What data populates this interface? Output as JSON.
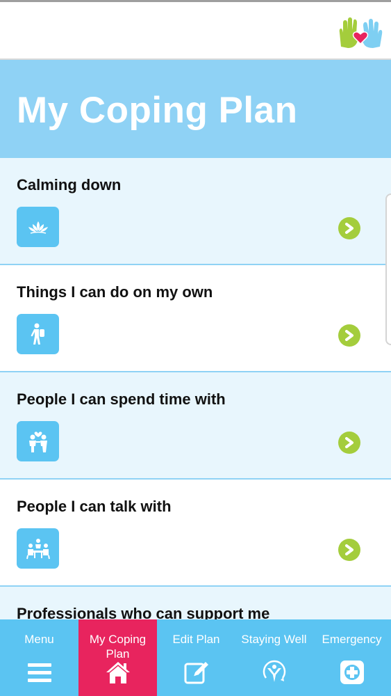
{
  "header": {
    "logo_icon": "helping-hands-heart-logo"
  },
  "page": {
    "title": "My Coping Plan"
  },
  "items": [
    {
      "label": "Calming down",
      "icon": "lotus-icon"
    },
    {
      "label": "Things I can do on my own",
      "icon": "hiker-icon"
    },
    {
      "label": "People I can spend time with",
      "icon": "couple-icon"
    },
    {
      "label": "People I can talk with",
      "icon": "group-talk-icon"
    },
    {
      "label": "Professionals who can support me",
      "icon": "professional-icon"
    }
  ],
  "nav": {
    "menu": "Menu",
    "coping_plan": "My Coping Plan",
    "edit_plan": "Edit Plan",
    "staying_well": "Staying Well",
    "emergency": "Emergency"
  },
  "colors": {
    "header_band": "#8fd2f5",
    "tile_blue": "#5bc4f2",
    "chevron_green": "#a4cd3c",
    "active_nav": "#e8245e",
    "row_tint": "#e8f6fd"
  }
}
